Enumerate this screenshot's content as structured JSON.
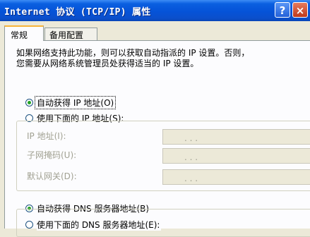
{
  "window": {
    "title": "Internet 协议 (TCP/IP) 属性",
    "help_label": "?",
    "close_label": "×"
  },
  "tabs": [
    {
      "label": "常规",
      "active": true
    },
    {
      "label": "备用配置",
      "active": false
    }
  ],
  "description": {
    "line1": "如果网络支持此功能，则可以获取自动指派的 IP 设置。否则，",
    "line2": "您需要从网络系统管理员处获得适当的 IP 设置。"
  },
  "ip_options": {
    "auto": {
      "label": "自动获得 IP 地址(O)",
      "selected": true
    },
    "manual": {
      "label": "使用下面的 IP 地址(S):",
      "selected": false
    }
  },
  "ip_fields": [
    {
      "label": "IP 地址(I):",
      "value": "",
      "dots": ".   .   ."
    },
    {
      "label": "子网掩码(U):",
      "value": "",
      "dots": ".   .   ."
    },
    {
      "label": "默认网关(D):",
      "value": "",
      "dots": ".   .   ."
    }
  ],
  "dns_options": {
    "auto": {
      "label": "自动获得 DNS 服务器地址(B)",
      "selected": true
    },
    "manual": {
      "label": "使用下面的 DNS 服务器地址(E):",
      "selected": false
    }
  },
  "colors": {
    "title_bar": "#0553d8",
    "dialog_bg": "#ece9d8",
    "radio_dot": "#21a121",
    "disabled_text": "#a1a192"
  }
}
